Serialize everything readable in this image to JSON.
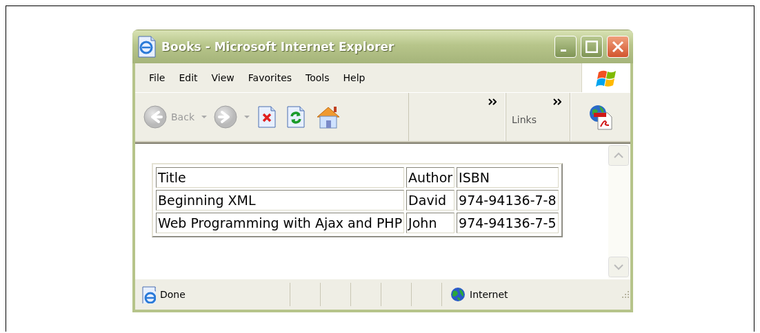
{
  "window": {
    "title": "Books - Microsoft Internet Explorer"
  },
  "menu": [
    "File",
    "Edit",
    "View",
    "Favorites",
    "Tools",
    "Help"
  ],
  "toolbar": [
    {
      "kind": "back",
      "label": "Back",
      "disabled": true
    },
    {
      "kind": "forward",
      "disabled": true
    },
    {
      "kind": "stop",
      "disabled": false
    },
    {
      "kind": "refresh",
      "disabled": false
    },
    {
      "kind": "home",
      "disabled": false
    }
  ],
  "links": {
    "label": "Links"
  },
  "table": {
    "columns": [
      "Title",
      "Author",
      "ISBN"
    ],
    "rows": [
      [
        "Beginning XML",
        "David",
        "974-94136-7-8"
      ],
      [
        "Web Programming with Ajax and PHP",
        "John",
        "974-94136-7-5"
      ]
    ]
  },
  "status_bar": {
    "status": "Done",
    "zone": "Internet"
  }
}
